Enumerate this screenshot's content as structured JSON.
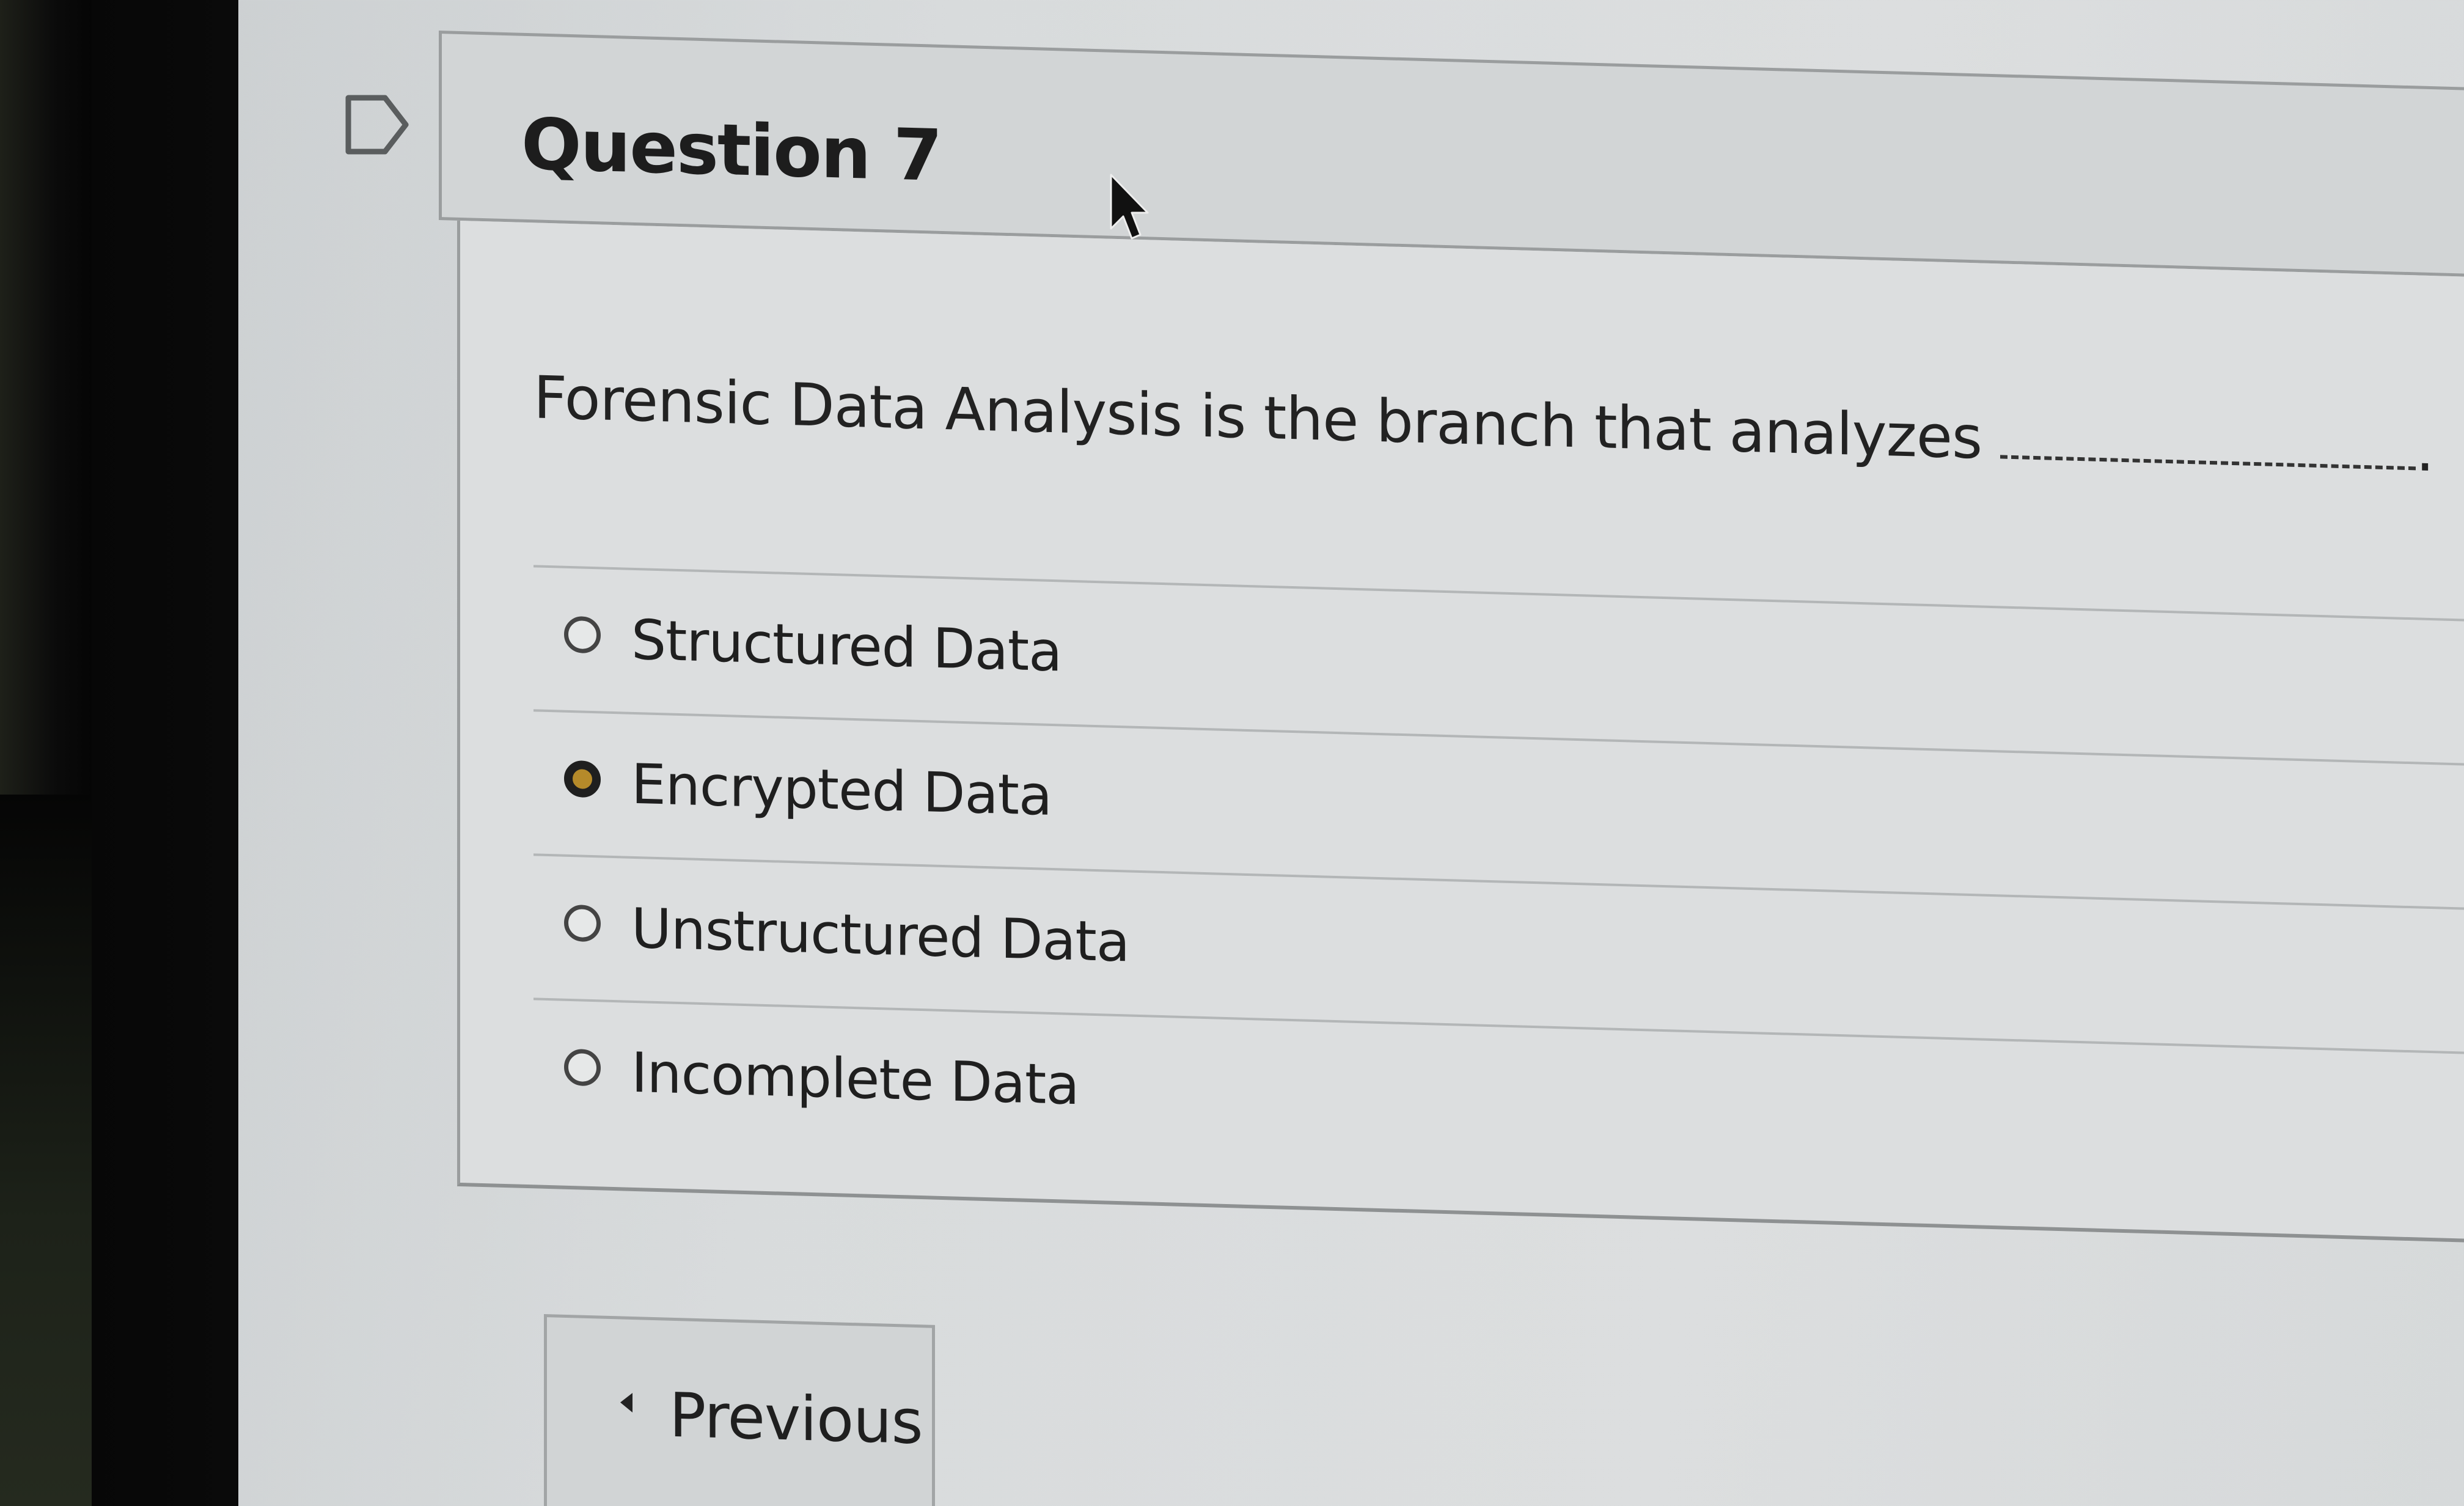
{
  "question": {
    "title": "Question 7",
    "text": "Forensic Data Analysis is the branch that analyzes",
    "blank_suffix": "."
  },
  "options": [
    {
      "label": "Structured Data",
      "selected": false
    },
    {
      "label": "Encrypted Data",
      "selected": true
    },
    {
      "label": "Unstructured Data",
      "selected": false
    },
    {
      "label": "Incomplete Data",
      "selected": false
    }
  ],
  "navigation": {
    "previous_label": "Previous"
  },
  "colors": {
    "selected_radio_fill": "#b58a2a",
    "header_background": "#d2d5d6",
    "body_background": "#dcdedf"
  },
  "icons": {
    "flag": "flag-outline-icon",
    "cursor": "mouse-pointer-icon",
    "previous": "chevron-left-icon"
  }
}
